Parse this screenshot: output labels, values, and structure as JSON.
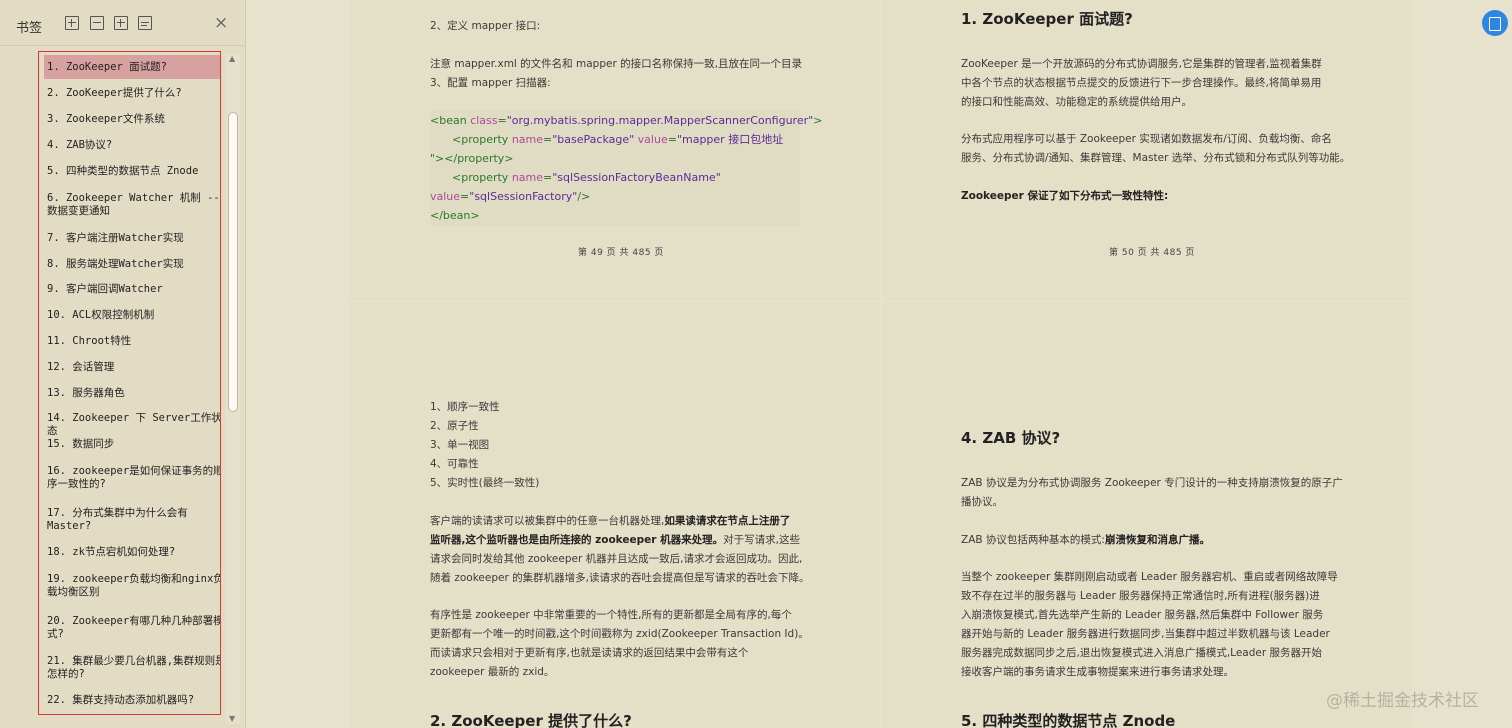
{
  "sidebar": {
    "title": "书签",
    "close": "×",
    "bookmarks": [
      "1. ZooKeeper 面试题?",
      "2. ZooKeeper提供了什么?",
      "3. Zookeeper文件系统",
      "4. ZAB协议?",
      "5. 四种类型的数据节点 Znode",
      "6. Zookeeper Watcher 机制 -- 数据变更通知",
      "7. 客户端注册Watcher实现",
      "8. 服务端处理Watcher实现",
      "9. 客户端回调Watcher",
      "10. ACL权限控制机制",
      "11. Chroot特性",
      "12. 会话管理",
      "13. 服务器角色",
      "14. Zookeeper 下 Server工作状态",
      "15. 数据同步",
      "16. zookeeper是如何保证事务的顺序一致性的?",
      "17. 分布式集群中为什么会有Master?",
      "18. zk节点宕机如何处理?",
      "19. zookeeper负载均衡和nginx负载均衡区别",
      "20. Zookeeper有哪几种几种部署模式?",
      "21. 集群最少要几台机器,集群规则是怎样的?",
      "22. 集群支持动态添加机器吗?"
    ]
  },
  "page49": {
    "l1": "2、定义 mapper 接口:",
    "l2": "注意 mapper.xml 的文件名和 mapper 的接口名称保持一致,且放在同一个目录",
    "l3": "3、配置 mapper 扫描器:",
    "code": {
      "c1a": "<bean ",
      "c1b": "class",
      "c1c": "=",
      "c1d": "\"org.mybatis.spring.mapper.MapperScannerConfigurer\"",
      "c1e": ">",
      "c2a": "<property ",
      "c2b": "name",
      "c2c": "=",
      "c2d": "\"basePackage\"",
      "c2e": " value",
      "c2f": "=",
      "c2g": "\"mapper 接口包地址",
      "c3": "\"></property>",
      "c4a": "<property ",
      "c4b": "name",
      "c4c": "=",
      "c4d": "\"sqlSessionFactoryBeanName\"",
      "c5a": "value",
      "c5b": "=",
      "c5c": "\"sqlSessionFactory\"",
      "c5d": "/>",
      "c6": "</bean>"
    },
    "footer": "第 49 页 共 485 页"
  },
  "page50": {
    "heading": "1. ZooKeeper 面试题?",
    "p1a": "ZooKeeper 是一个开放源码的分布式协调服务,它是集群的管理者,监视着集群",
    "p1b": "中各个节点的状态根据节点提交的反馈进行下一步合理操作。最终,将简单易用",
    "p1c": "的接口和性能高效、功能稳定的系统提供给用户。",
    "p2a": "分布式应用程序可以基于 Zookeeper 实现诸如数据发布/订阅、负载均衡、命名",
    "p2b": "服务、分布式协调/通知、集群管理、Master 选举、分布式锁和分布式队列等功能。",
    "p3": "Zookeeper 保证了如下分布式一致性特性:",
    "footer": "第 50 页 共 485 页"
  },
  "page51": {
    "li1": "1、顺序一致性",
    "li2": "2、原子性",
    "li3": "3、单一视图",
    "li4": "4、可靠性",
    "li5": "5、实时性(最终一致性)",
    "p1a": "客户端的读请求可以被集群中的任意一台机器处理,",
    "p1b_bold": "如果读请求在节点上注册了",
    "p1c_bold": "监听器,这个监听器也是由所连接的 zookeeper 机器来处理。",
    "p1d": "对于写请求,这些",
    "p1e": "请求会同时发给其他 zookeeper 机器并且达成一致后,请求才会返回成功。因此,",
    "p1f": "随着 zookeeper 的集群机器增多,读请求的吞吐会提高但是写请求的吞吐会下降。",
    "p2a": "有序性是 zookeeper 中非常重要的一个特性,所有的更新都是全局有序的,每个",
    "p2b": "更新都有一个唯一的时间戳,这个时间戳称为 zxid(Zookeeper Transaction Id)。",
    "p2c": "而读请求只会相对于更新有序,也就是读请求的返回结果中会带有这个",
    "p2d": "zookeeper 最新的 zxid。",
    "heading2": "2. ZooKeeper 提供了什么?"
  },
  "page52": {
    "heading": "4. ZAB 协议?",
    "p1a": "ZAB 协议是为分布式协调服务 Zookeeper 专门设计的一种支持崩溃恢复的原子广",
    "p1b": "播协议。",
    "p2a": "ZAB 协议包括两种基本的模式:",
    "p2b_bold": "崩溃恢复和消息广播。",
    "p3a": "当整个 zookeeper 集群刚刚启动或者 Leader 服务器宕机、重启或者网络故障导",
    "p3b": "致不存在过半的服务器与 Leader 服务器保持正常通信时,所有进程(服务器)进",
    "p3c": "入崩溃恢复模式,首先选举产生新的 Leader 服务器,然后集群中 Follower 服务",
    "p3d": "器开始与新的 Leader 服务器进行数据同步,当集群中超过半数机器与该 Leader",
    "p3e": "服务器完成数据同步之后,退出恢复模式进入消息广播模式,Leader 服务器开始",
    "p3f": "接收客户端的事务请求生成事物提案来进行事务请求处理。",
    "heading2": "5. 四种类型的数据节点 Znode"
  },
  "watermark": "@稀土掘金技术社区"
}
